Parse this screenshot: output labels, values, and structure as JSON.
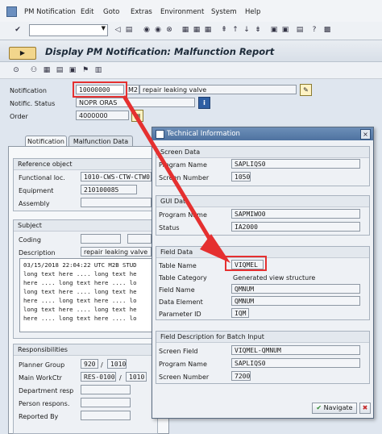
{
  "menu": [
    "PM Notification",
    "Edit",
    "Goto",
    "Extras",
    "Environment",
    "System",
    "Help"
  ],
  "header": {
    "title": "Display PM Notification: Malfunction Report",
    "notification_label": "Notification",
    "notification_value": "10000000",
    "notification_type": "M2",
    "notification_text": "repair leaking valve",
    "status_label": "Notific. Status",
    "status_value": "NOPR ORAS",
    "order_label": "Order",
    "order_value": "4000000"
  },
  "tabs": [
    "Notification",
    "Malfunction Data"
  ],
  "reference": {
    "title": "Reference object",
    "functional_loc_label": "Functional loc.",
    "functional_loc_value": "1010-CWS-CTW-CTW0",
    "equipment_label": "Equipment",
    "equipment_value": "210100085",
    "assembly_label": "Assembly"
  },
  "subject": {
    "title": "Subject",
    "coding_label": "Coding",
    "description_label": "Description",
    "description_value": "repair leaking valve",
    "longtext": [
      "03/15/2018 22:04:22 UTC M2B STUD",
      "long text here .... long text he",
      "here .... long text here .... lo",
      "long text here .... long text he",
      "here .... long text here .... lo",
      "long text here .... long text he",
      "here .... long text here .... lo"
    ]
  },
  "responsibilities": {
    "title": "Responsibilities",
    "planner_group_label": "Planner Group",
    "planner_group_value": "920",
    "planner_plant": "1010",
    "main_workctr_label": "Main WorkCtr",
    "main_workctr_value": "RES-0100",
    "main_workctr_plant": "1010",
    "dept_label": "Department resp",
    "person_label": "Person respons.",
    "reported_label": "Reported By"
  },
  "dialog": {
    "title": "Technical Information",
    "screen_data": {
      "title": "Screen Data",
      "program_name_label": "Program Name",
      "program_name_value": "SAPLIQS0",
      "screen_number_label": "Screen Number",
      "screen_number_value": "1050"
    },
    "gui_data": {
      "title": "GUI Data",
      "program_name_label": "Program Name",
      "program_name_value": "SAPMIWO0",
      "status_label": "Status",
      "status_value": "IA2000"
    },
    "field_data": {
      "title": "Field Data",
      "table_name_label": "Table Name",
      "table_name_value": "VIQMEL",
      "table_category_label": "Table Category",
      "table_category_value": "Generated view structure",
      "field_name_label": "Field Name",
      "field_name_value": "QMNUM",
      "data_element_label": "Data Element",
      "data_element_value": "QMNUM",
      "parameter_id_label": "Parameter ID",
      "parameter_id_value": "IQM"
    },
    "batch": {
      "title": "Field Description for Batch Input",
      "screen_field_label": "Screen Field",
      "screen_field_value": "VIQMEL-QMNUM",
      "program_name_label": "Program Name",
      "program_name_value": "SAPLIQS0",
      "screen_number_label": "Screen Number",
      "screen_number_value": "7200"
    },
    "navigate_label": "Navigate"
  },
  "colors": {
    "arrow": "#e53030",
    "dialog_title": "#4e72a0"
  }
}
